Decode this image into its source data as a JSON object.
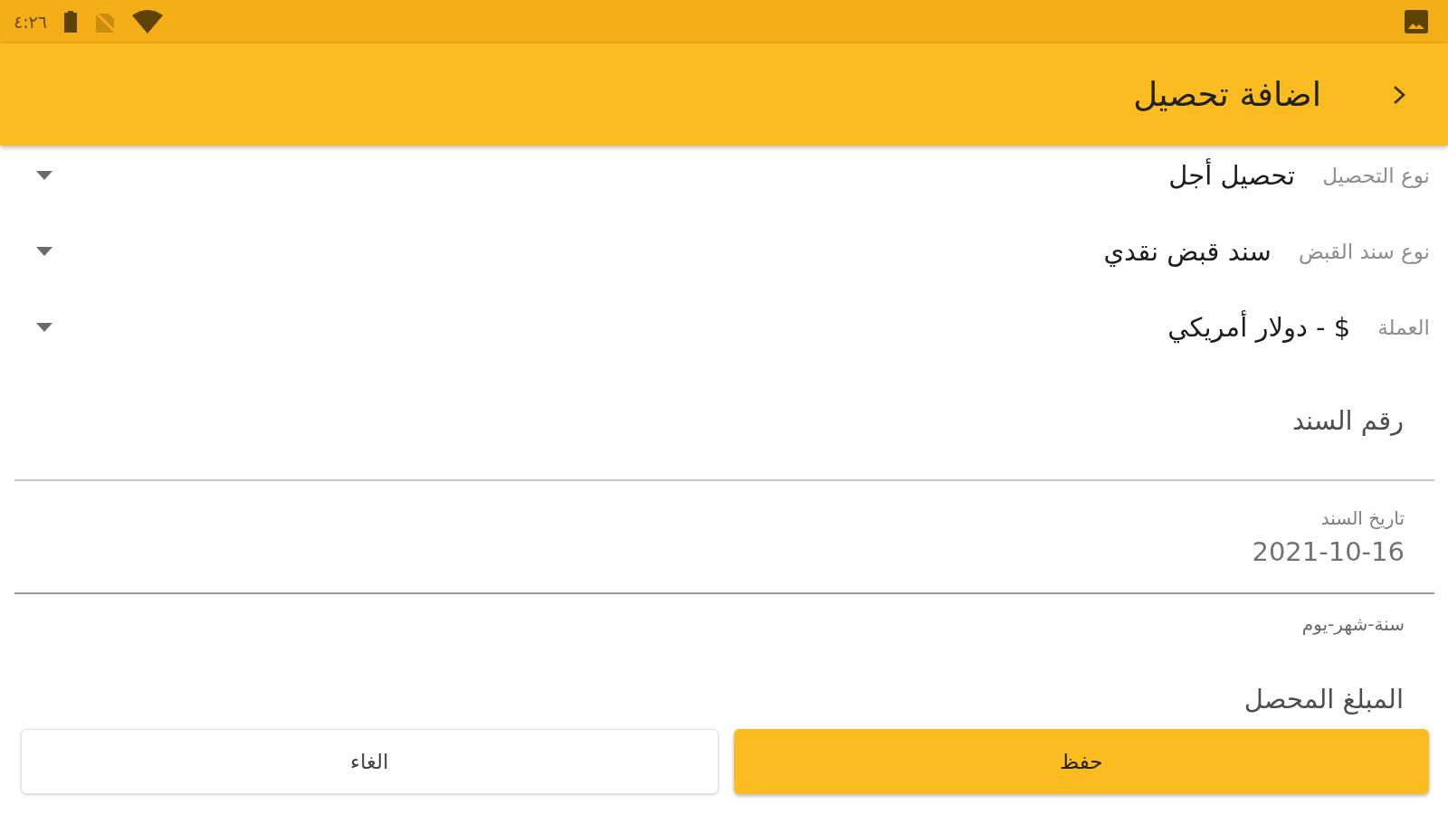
{
  "status_bar": {
    "time": "٤:٢٦"
  },
  "app_bar": {
    "title": "اضافة تحصيل"
  },
  "fields": [
    {
      "kind": "dropdown",
      "label": "نوع التحصيل",
      "value": "تحصيل أجل"
    },
    {
      "kind": "dropdown",
      "label": "نوع سند القبض",
      "value": "سند قبض نقدي"
    },
    {
      "kind": "dropdown",
      "label": "العملة",
      "value": "$ - دولار أمريكي"
    },
    {
      "kind": "text",
      "placeholder": "رقم السند"
    },
    {
      "kind": "date",
      "label": "تاريخ السند",
      "value": "2021-10-16",
      "helper": "سنة-شهر-يوم"
    },
    {
      "kind": "text",
      "placeholder": "المبلغ المحصل"
    }
  ],
  "buttons": [
    {
      "kind": "primary",
      "label": "حفظ"
    },
    {
      "kind": "secondary",
      "label": "الغاء"
    }
  ]
}
